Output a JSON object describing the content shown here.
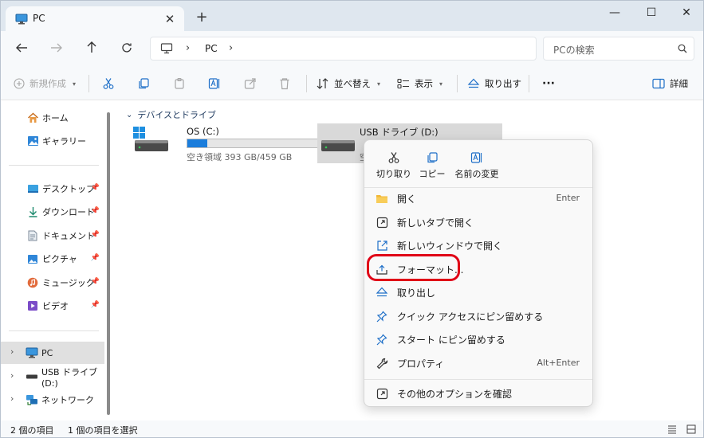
{
  "window": {
    "tab_title": "PC",
    "new_tab_label": "+",
    "close_tab_label": "✕",
    "controls": {
      "minimize": "—",
      "maximize": "☐",
      "close": "✕"
    }
  },
  "address": {
    "path": "PC",
    "search_placeholder": "PCの検索"
  },
  "toolbar": {
    "new_label": "新規作成",
    "sort_label": "並べ替え",
    "view_label": "表示",
    "eject_label": "取り出す",
    "more_label": "···",
    "details_label": "詳細"
  },
  "sidebar": {
    "home": "ホーム",
    "gallery": "ギャラリー",
    "desktop": "デスクトップ",
    "downloads": "ダウンロード",
    "documents": "ドキュメント",
    "pictures": "ピクチャ",
    "music": "ミュージック",
    "videos": "ビデオ",
    "pc": "PC",
    "usb": "USB ドライブ (D:)",
    "network": "ネットワーク"
  },
  "content": {
    "group_header": "デバイスとドライブ",
    "drives": [
      {
        "name": "OS (C:)",
        "detail": "空き領域 393 GB/459 GB",
        "used_fraction": 0.144
      },
      {
        "name": "USB ドライブ (D:)",
        "detail": "空"
      }
    ]
  },
  "status": {
    "item_count": "2 個の項目",
    "selected_count": "1 個の項目を選択"
  },
  "context_menu": {
    "quick": {
      "cut": "切り取り",
      "copy": "コピー",
      "rename": "名前の変更"
    },
    "items": {
      "open": "開く",
      "open_shortcut": "Enter",
      "open_new_tab": "新しいタブで開く",
      "open_new_window": "新しいウィンドウで開く",
      "format": "フォーマット...",
      "eject": "取り出し",
      "pin_quick_access": "クイック アクセスにピン留めする",
      "pin_start": "スタート にピン留めする",
      "properties": "プロパティ",
      "properties_shortcut": "Alt+Enter",
      "more_options": "その他のオプションを確認"
    }
  },
  "colors": {
    "accent": "#1a7ddc",
    "highlight": "#e00016"
  }
}
